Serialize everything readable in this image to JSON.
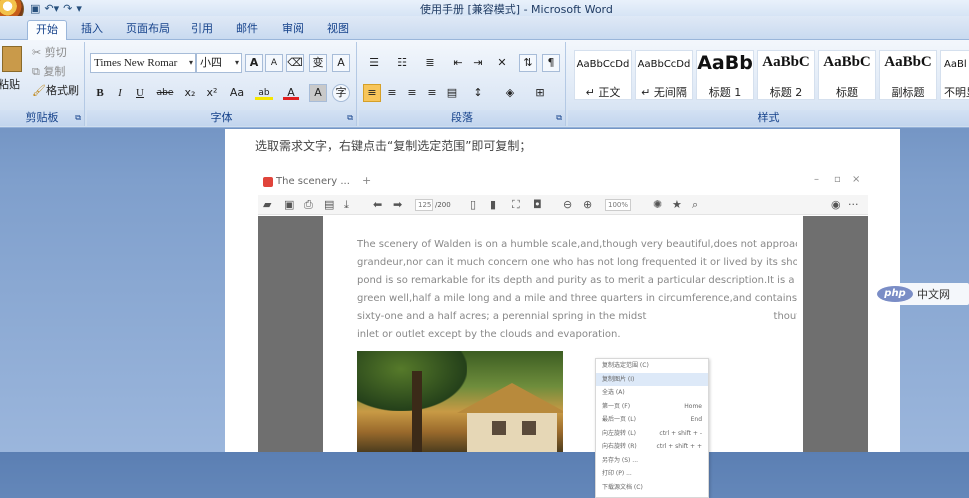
{
  "window": {
    "title": "使用手册 [兼容模式] - Microsoft Word"
  },
  "quick_access": [
    "save-icon",
    "undo-icon",
    "redo-icon",
    "customize-icon"
  ],
  "tabs": [
    "开始",
    "插入",
    "页面布局",
    "引用",
    "邮件",
    "审阅",
    "视图"
  ],
  "ribbon": {
    "clipboard": {
      "label": "剪贴板",
      "paste": "粘贴",
      "cut": "剪切",
      "copy": "复制",
      "format_painter": "格式刷"
    },
    "font": {
      "label": "字体",
      "font_name": "Times New Romar",
      "font_size": "小四",
      "grow": "A",
      "shrink": "A",
      "phonetic": "变",
      "border_char": "A",
      "bold": "B",
      "italic": "I",
      "underline": "U",
      "strike": "abe",
      "subscript": "x₂",
      "superscript": "x²",
      "change_case": "Aa",
      "highlight": "ab",
      "font_color": "A",
      "shading": "A",
      "enclose": "字",
      "highlight_color": "#f5e600",
      "font_color_value": "#e02020"
    },
    "paragraph": {
      "label": "段落"
    },
    "styles": {
      "label": "样式",
      "items": [
        {
          "sample": "AaBbCcDd",
          "name": "正文"
        },
        {
          "sample": "AaBbCcDd",
          "name": "无间隔"
        },
        {
          "sample": "AaBb",
          "name": "标题 1"
        },
        {
          "sample": "AaBbC",
          "name": "标题 2"
        },
        {
          "sample": "AaBbC",
          "name": "标题"
        },
        {
          "sample": "AaBbC",
          "name": "副标题"
        },
        {
          "sample": "AaBl",
          "name": "不明显"
        }
      ]
    }
  },
  "document": {
    "instruction": "选取需求文字，右键点击“复制选定范围”即可复制；"
  },
  "browser": {
    "tab_title": "The scenery ...",
    "tab_close": "×",
    "new_tab": "+",
    "win_min": "–",
    "win_restore": "▫",
    "win_close": "×",
    "page_input": "125",
    "page_total": "/200",
    "zoom": "100%",
    "more": "···"
  },
  "pdf": {
    "paragraph": [
      "The scenery of Walden is on a humble scale,and,though very beautiful,does not approach to",
      "grandeur,nor can it much concern one who has not long frequented it or lived by its shore; yet this",
      "pond is so remarkable for its depth and purity as to merit a particular description.It is a clear and deep",
      "green well,half a mile long and a mile and three quarters in circumference,and contains about",
      "sixty-one and a half acres; a perennial spring in the midst                                        thout any visible",
      "inlet or outlet except by the clouds and evaporation."
    ]
  },
  "context_menu": {
    "items": [
      {
        "label": "复制选定范围  (C)",
        "shortcut": ""
      },
      {
        "label": "复制图片  (I)",
        "shortcut": ""
      },
      {
        "label": "全选  (A)",
        "shortcut": ""
      },
      {
        "label": "第一页  (F)",
        "shortcut": "Home"
      },
      {
        "label": "最后一页  (L)",
        "shortcut": "End"
      },
      {
        "label": "向左旋转  (L)",
        "shortcut": "ctrl + shift + -"
      },
      {
        "label": "向右旋转  (R)",
        "shortcut": "ctrl + shift + +"
      },
      {
        "label": "另存为  (S) ...",
        "shortcut": ""
      },
      {
        "label": "打印  (P) ...",
        "shortcut": ""
      },
      {
        "label": "下载源文档  (C)",
        "shortcut": ""
      }
    ],
    "highlighted_index": 1
  },
  "watermark": {
    "logo": "php",
    "text": "中文网"
  }
}
